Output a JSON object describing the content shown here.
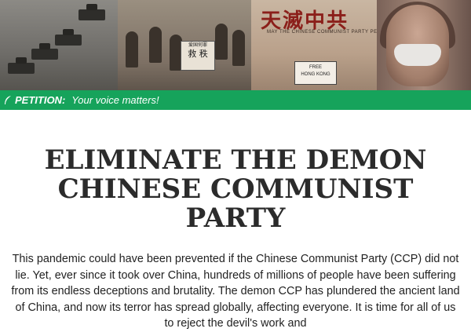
{
  "banner": {
    "chinese_title": "天滅中共",
    "caption": "MAY THE CHINESE COMMUNIST PARTY PERISH",
    "sign_text_top": "爱国何罪",
    "sign_text": "救 秩",
    "hk_sign_line1": "FREE",
    "hk_sign_line2": "HONG KONG"
  },
  "petition_bar": {
    "label": "PETITION:",
    "message": "Your voice matters!",
    "color": "#16a35b"
  },
  "article": {
    "headline": "ELIMINATE THE DEMON CHINESE COMMUNIST PARTY",
    "body": "This pandemic could have been prevented if the Chinese Communist Party (CCP) did not lie. Yet, ever since it took over China, hundreds of millions of people have been suffering from its endless deceptions and brutality. The demon CCP has plundered the ancient land of China, and now its terror has spread globally, affecting everyone. It is time for all of us to reject the devil's work and"
  }
}
